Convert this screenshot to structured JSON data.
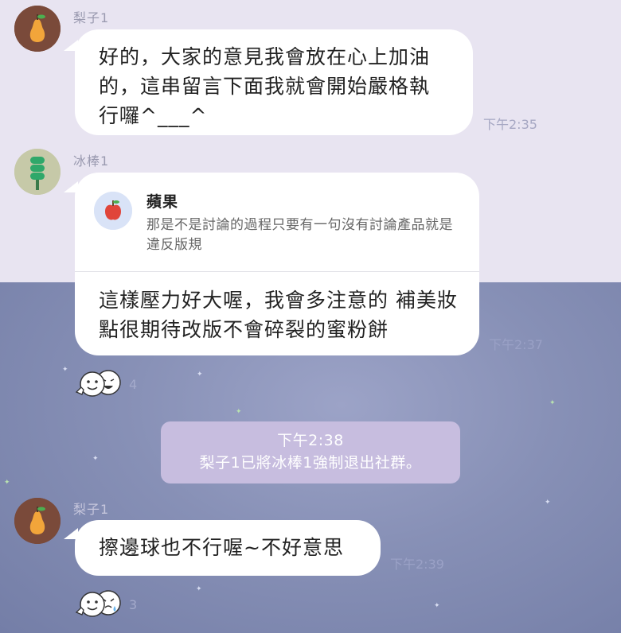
{
  "messages": [
    {
      "sender": "梨子1",
      "avatar_icon": "pear-icon",
      "text": "好的，大家的意見我會放在心上加油的，這串留言下面我就會開始嚴格執行囉^___^",
      "time": "下午2:35"
    },
    {
      "sender": "冰棒1",
      "avatar_icon": "popsicle-icon",
      "reply_to": {
        "icon": "apple-icon",
        "name": "蘋果",
        "text": "那是不是討論的過程只要有一句沒有討論產品就是違反版規"
      },
      "text": "這樣壓力好大喔，我會多注意的 補美妝點很期待改版不會碎裂的蜜粉餅",
      "time": "下午2:37",
      "reactions_count": "4"
    },
    {
      "sender": "梨子1",
      "avatar_icon": "pear-icon",
      "text": "擦邊球也不行喔~不好意思",
      "time": "下午2:39",
      "reactions_count": "3"
    }
  ],
  "system_notice": {
    "time": "下午2:38",
    "text": "梨子1已將冰棒1強制退出社群。"
  },
  "colors": {
    "top_background": "#e8e4f1",
    "night_background": "#8a93b7",
    "bubble": "#ffffff",
    "system_bubble": "#c7bddf",
    "avatar_brown": "#7a4a3a",
    "pear_orange": "#f2a53a",
    "popsicle_green": "#2fa86a"
  }
}
